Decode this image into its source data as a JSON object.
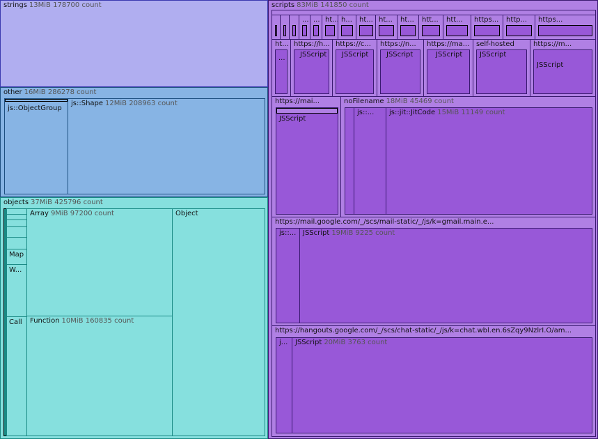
{
  "strings": {
    "name": "strings",
    "size": "13MiB",
    "count": "178700 count"
  },
  "other": {
    "name": "other",
    "size": "16MiB",
    "count": "286278 count",
    "objectgroup": "js::ObjectGroup",
    "shape": {
      "name": "js::Shape",
      "size": "12MiB",
      "count": "208963 count"
    }
  },
  "objects": {
    "name": "objects",
    "size": "37MiB",
    "count": "425796 count",
    "array": {
      "name": "Array",
      "size": "9MiB",
      "count": "97200 count"
    },
    "object": "Object",
    "map": "Map",
    "w": "W...",
    "call": "Call",
    "function": {
      "name": "Function",
      "size": "10MiB",
      "count": "160835 count"
    }
  },
  "scripts": {
    "name": "scripts",
    "size": "83MiB",
    "count": "141850 count",
    "row1": [
      "...",
      "...",
      "ht...",
      "h...",
      "ht...",
      "ht...",
      "ht...",
      "htt...",
      "htt...",
      "https...",
      "http...",
      "https..."
    ],
    "row2": [
      "ht...",
      "https://h...",
      "https://c...",
      "https://n...",
      "https://ma...",
      "self-hosted",
      "https://m..."
    ],
    "row2_inner": [
      "...",
      "JSScript",
      "JSScript",
      "JSScript",
      "JSScript",
      "JSScript",
      "JSScript"
    ],
    "mai": "https://mai...",
    "mai_inner": "JSScript",
    "nofile": {
      "name": "noFilename",
      "size": "18MiB",
      "count": "45469 count",
      "js": "js::...",
      "jit": {
        "name": "js::jit::JitCode",
        "size": "15MiB",
        "count": "11149 count"
      }
    },
    "gmail": {
      "name": "https://mail.google.com/_/scs/mail-static/_/js/k=gmail.main.e...",
      "js": "js::...",
      "jsscript": {
        "name": "JSScript",
        "size": "19MiB",
        "count": "9225 count"
      }
    },
    "hangouts": {
      "name": "https://hangouts.google.com/_/scs/chat-static/_/js/k=chat.wbl.en.6sZqy9NzlrI.O/am...",
      "j": "j...",
      "jsscript": {
        "name": "JSScript",
        "size": "20MiB",
        "count": "3763 count"
      }
    }
  }
}
